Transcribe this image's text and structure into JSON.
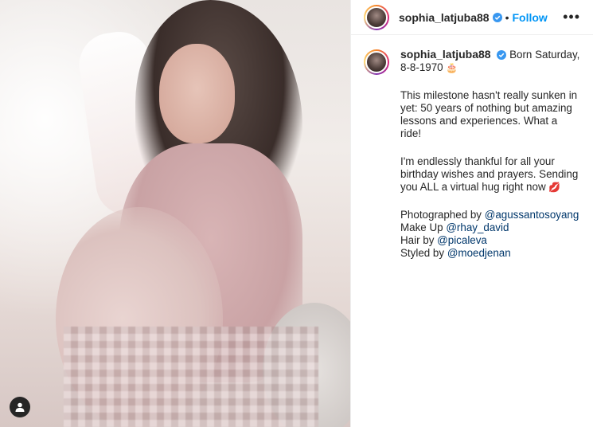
{
  "post": {
    "username": "sophia_latjuba88",
    "follow_label": "Follow",
    "separator": "•",
    "more_label": "•••"
  },
  "caption": {
    "username": "sophia_latjuba88",
    "intro": "Born Saturday, 8-8-1970",
    "intro_emoji": "🎂",
    "para1": "This milestone hasn't really sunken in yet: 50 years of nothing but amazing lessons and experiences. What a ride!",
    "para2": "I'm endlessly thankful for all your birthday wishes and prayers. Sending you ALL a virtual hug right now",
    "para2_emoji": "💋",
    "credits": [
      {
        "label": "Photographed by",
        "mention": "@agussantosoyang"
      },
      {
        "label": "Make Up",
        "mention": "@rhay_david"
      },
      {
        "label": "Hair by",
        "mention": "@picaleva"
      },
      {
        "label": "Styled by",
        "mention": "@moedjenan"
      }
    ]
  },
  "colors": {
    "follow": "#0095f6",
    "mention": "#00376b",
    "verified": "#3897f0"
  },
  "icons": [
    "verified-badge-icon",
    "more-options-icon",
    "user-tag-icon"
  ]
}
